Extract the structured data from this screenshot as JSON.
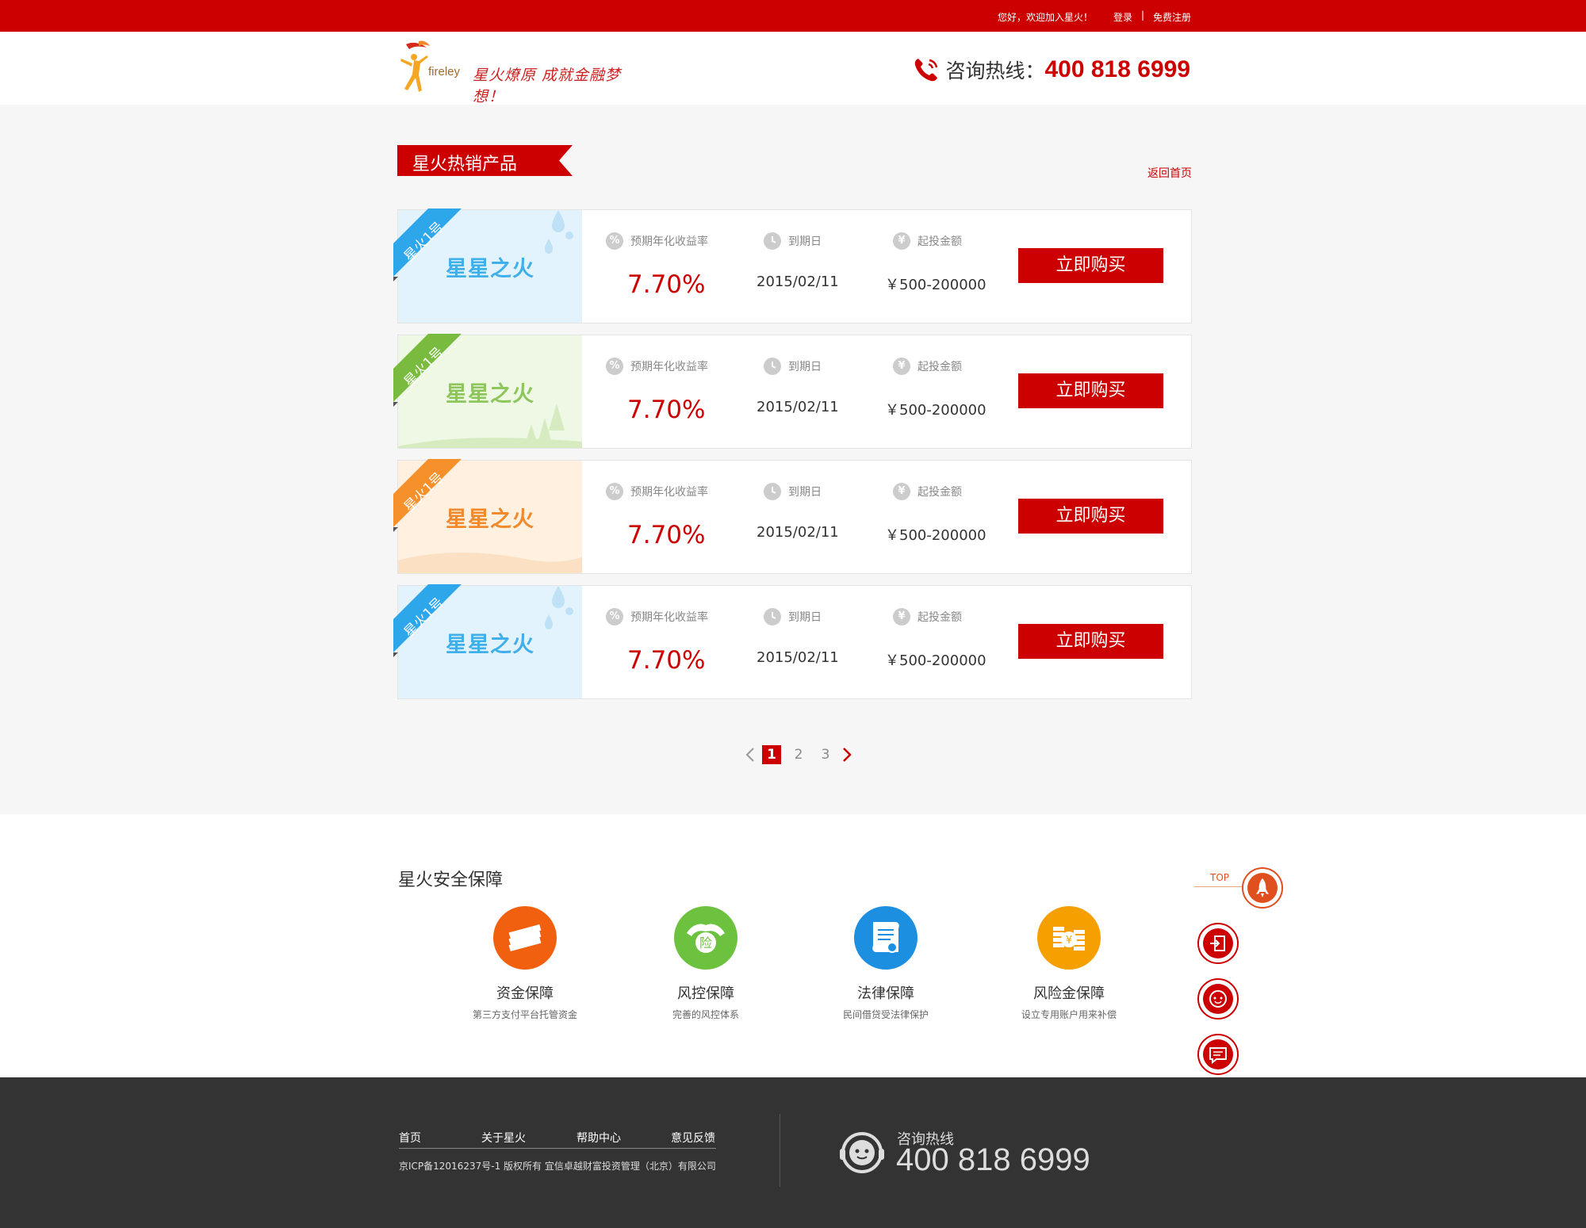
{
  "topbar": {
    "welcome": "您好，欢迎加入星火！",
    "login": "登录",
    "separator": "|",
    "register": "免费注册"
  },
  "header": {
    "brand": "fireley",
    "slogan": "星火燎原 成就金融梦想！",
    "hotline_label": "咨询热线：",
    "hotline_number": "400 818 6999"
  },
  "section": {
    "title": "星火热销产品",
    "back_home": "返回首页"
  },
  "metric_labels": {
    "rate": "预期年化收益率",
    "maturity": "到期日",
    "amount": "起投金额",
    "rate_icon": "%",
    "amount_icon": "¥"
  },
  "products": [
    {
      "tag": "星火1号",
      "name": "星星之火",
      "rate": "7.70%",
      "maturity": "2015/02/11",
      "amount": "￥500-200000",
      "buy": "立即购买",
      "theme": "blue"
    },
    {
      "tag": "星火1号",
      "name": "星星之火",
      "rate": "7.70%",
      "maturity": "2015/02/11",
      "amount": "￥500-200000",
      "buy": "立即购买",
      "theme": "green"
    },
    {
      "tag": "星火1号",
      "name": "星星之火",
      "rate": "7.70%",
      "maturity": "2015/02/11",
      "amount": "￥500-200000",
      "buy": "立即购买",
      "theme": "orange"
    },
    {
      "tag": "星火1号",
      "name": "星星之火",
      "rate": "7.70%",
      "maturity": "2015/02/11",
      "amount": "￥500-200000",
      "buy": "立即购买",
      "theme": "blue"
    }
  ],
  "themes": {
    "blue": {
      "bg": "#e3f3fd",
      "text": "#3fb0ea",
      "ribbon": "#2ea7ea"
    },
    "green": {
      "bg": "#eef8e4",
      "text": "#8dc65b",
      "ribbon": "#78bb3e"
    },
    "orange": {
      "bg": "#fff0e0",
      "text": "#f08a2c",
      "ribbon": "#f5902a"
    }
  },
  "pagination": {
    "pages": [
      "1",
      "2",
      "3"
    ],
    "current": "1"
  },
  "security": {
    "title": "星火安全保障",
    "items": [
      {
        "name": "资金保障",
        "desc": "第三方支付平台托管资金",
        "color": "#f0600e",
        "icon": "money-stack-icon"
      },
      {
        "name": "风控保障",
        "desc": "完善的风控体系",
        "color": "#6cc13e",
        "icon": "insurance-hands-icon",
        "icon_text": "险"
      },
      {
        "name": "法律保障",
        "desc": "民间借贷受法律保护",
        "color": "#1d8fe0",
        "icon": "contract-scroll-icon"
      },
      {
        "name": "风险金保障",
        "desc": "设立专用账户用来补偿",
        "color": "#f5a000",
        "icon": "coin-stack-icon",
        "icon_text": "¥"
      }
    ]
  },
  "side_tools": {
    "top_label": "TOP",
    "items": [
      "login-icon",
      "service-face-icon",
      "message-icon"
    ]
  },
  "footer": {
    "links": [
      "首页",
      "关于星火",
      "帮助中心",
      "意见反馈"
    ],
    "copyright": "京ICP备12016237号-1 版权所有 宜信卓越财富投资管理（北京）有限公司",
    "hotline_label": "咨询热线",
    "hotline_number": "400 818 6999"
  },
  "colors": {
    "brand_red": "#cc0000",
    "footer_bg": "#333333"
  }
}
